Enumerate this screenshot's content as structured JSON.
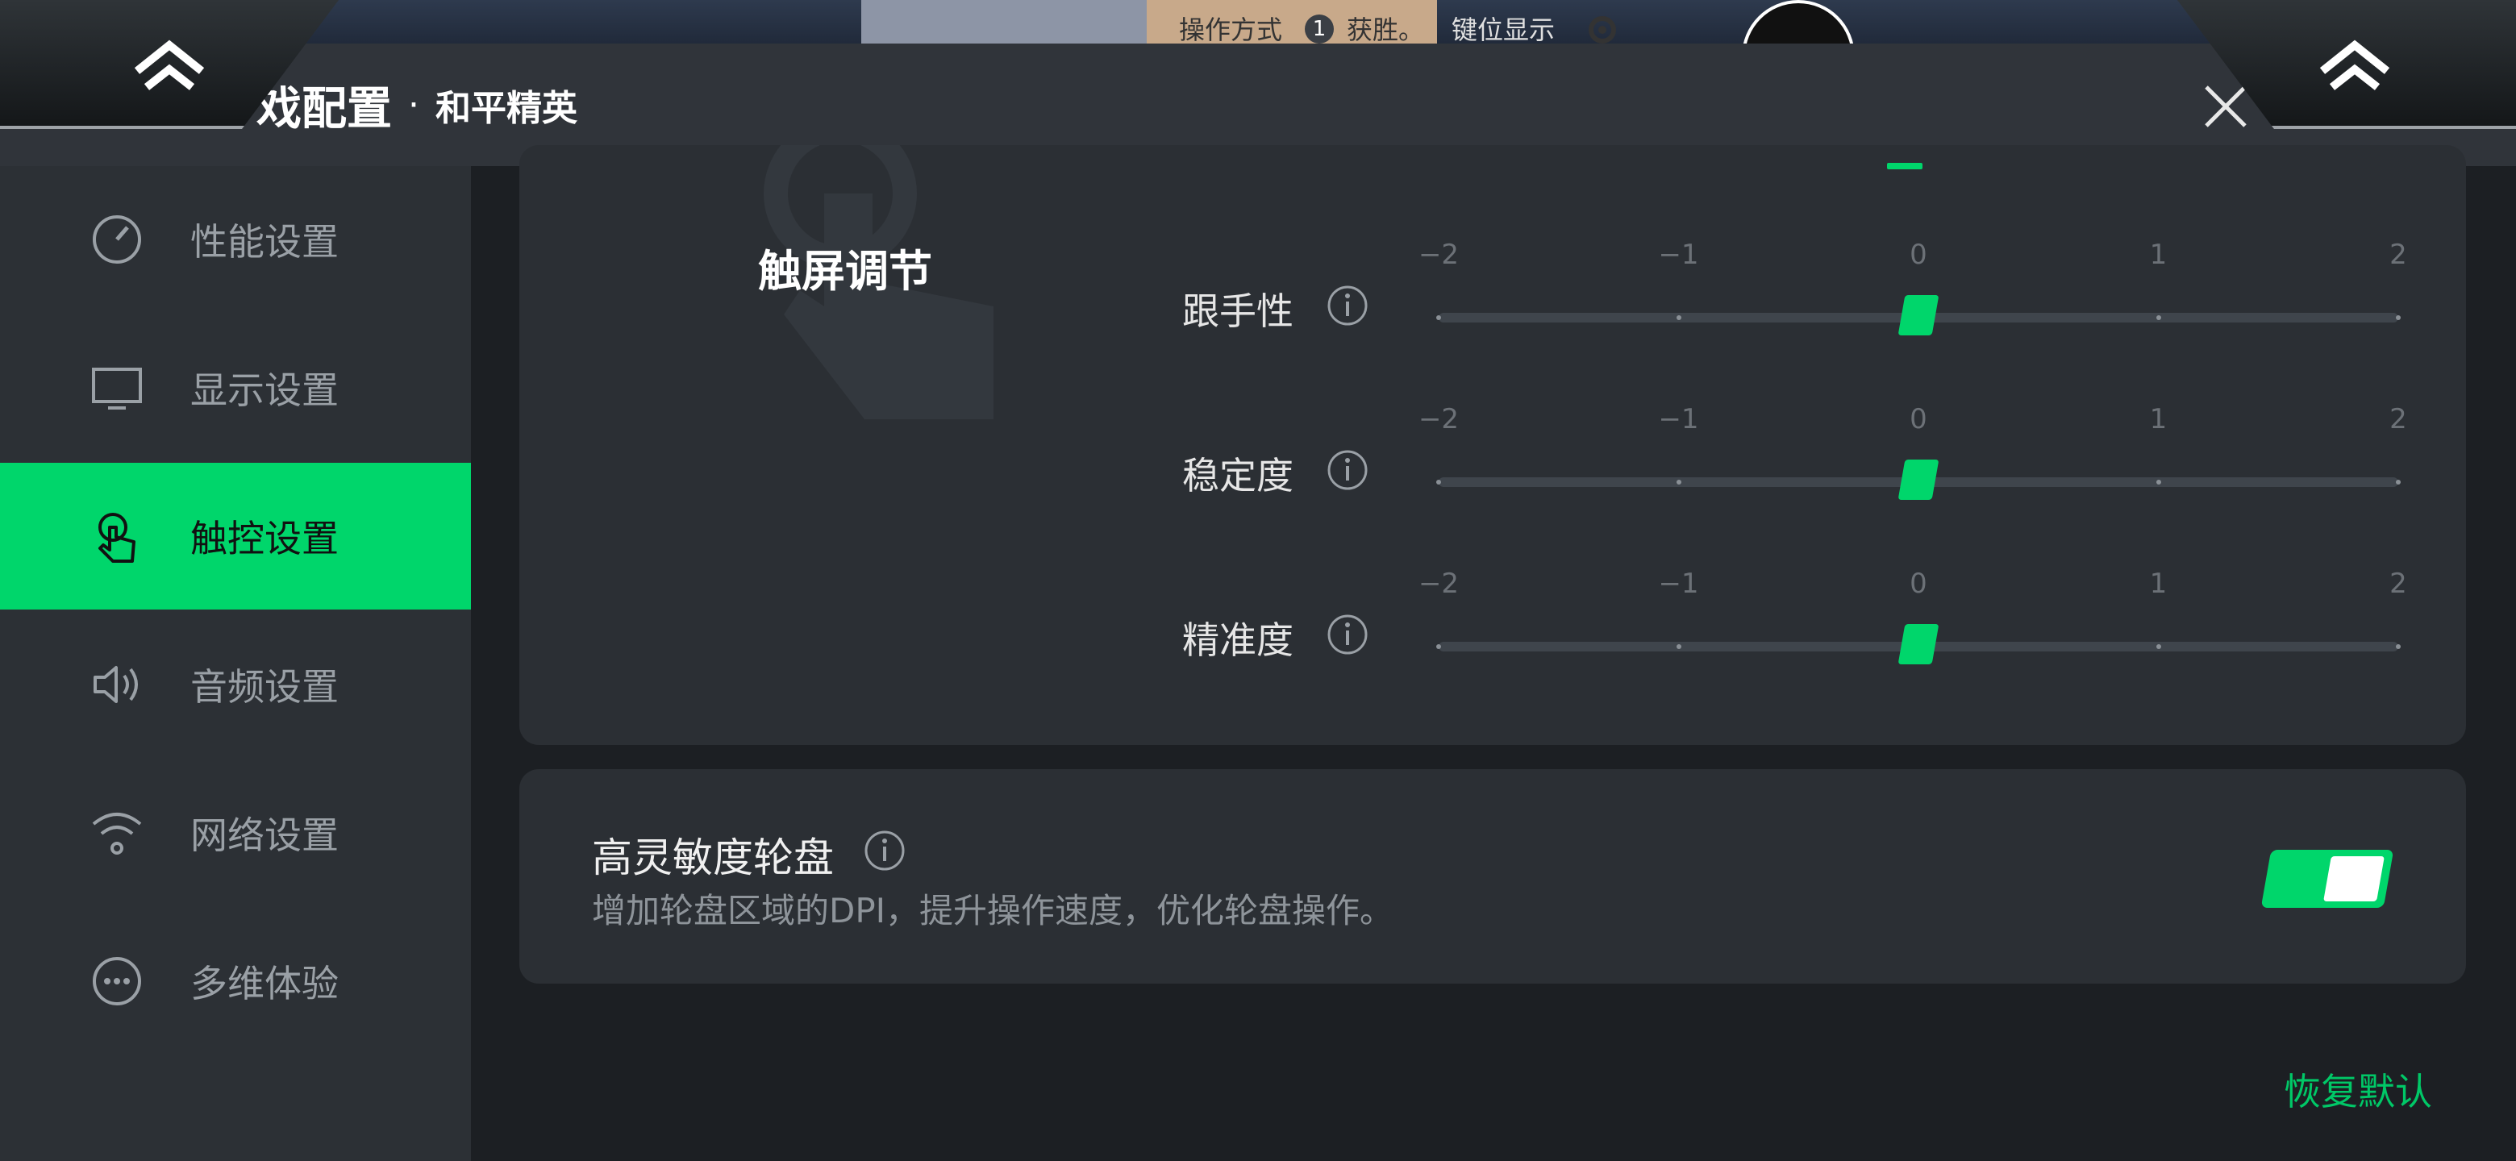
{
  "game_background": {
    "overlay_text_1": "操作方式",
    "overlay_badge": "1",
    "overlay_text_2": "获胜。",
    "overlay_text_3": "键位显示"
  },
  "header": {
    "title": "戏配置",
    "separator": "·",
    "subtitle": "和平精英"
  },
  "sidebar": {
    "items": [
      {
        "label": "性能设置",
        "icon": "speedometer-icon"
      },
      {
        "label": "显示设置",
        "icon": "monitor-icon"
      },
      {
        "label": "触控设置",
        "icon": "touch-icon",
        "active": true
      },
      {
        "label": "音频设置",
        "icon": "speaker-icon"
      },
      {
        "label": "网络设置",
        "icon": "wifi-icon"
      },
      {
        "label": "多维体验",
        "icon": "more-icon"
      }
    ]
  },
  "touch_section": {
    "title": "触屏调节",
    "tick_labels": [
      "−2",
      "−1",
      "0",
      "1",
      "2"
    ],
    "sliders": [
      {
        "label": "跟手性",
        "value": 0
      },
      {
        "label": "稳定度",
        "value": 0
      },
      {
        "label": "精准度",
        "value": 0
      }
    ]
  },
  "wheel_section": {
    "title": "高灵敏度轮盘",
    "description": "增加轮盘区域的DPI，提升操作速度，优化轮盘操作。",
    "enabled": true
  },
  "footer": {
    "restore_label": "恢复默认"
  },
  "colors": {
    "accent": "#00d66b",
    "sidebar_bg": "#2c3035",
    "card_bg": "#2b2f34",
    "page_bg": "#1c1f23"
  }
}
